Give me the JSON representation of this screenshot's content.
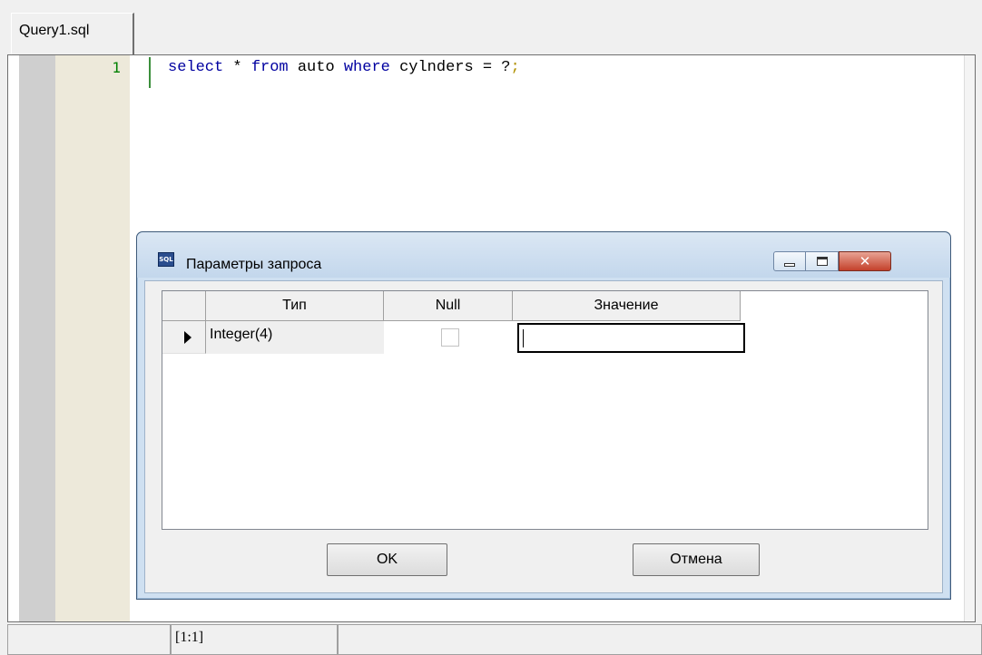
{
  "tabs": [
    {
      "label": "Query1.sql"
    }
  ],
  "editor": {
    "line_number": "1",
    "code": {
      "t1": "select",
      "t2": " * ",
      "t3": "from",
      "t4": " auto ",
      "t5": "where",
      "t6": " cylnders = ?",
      "t7": ";"
    }
  },
  "status": {
    "cell1": "",
    "position": "[1:1]",
    "cell3": ""
  },
  "dialog": {
    "title": "Параметры запроса",
    "icon": "sql-icon",
    "columns": [
      "Тип",
      "Null",
      "Значение"
    ],
    "rows": [
      {
        "type": "Integer(4)",
        "null": false,
        "value": ""
      }
    ],
    "ok_label": "OK",
    "cancel_label": "Отмена"
  },
  "colors": {
    "keyword": "#0000a0",
    "line_number": "#008000",
    "gutter": "#ede9da"
  }
}
